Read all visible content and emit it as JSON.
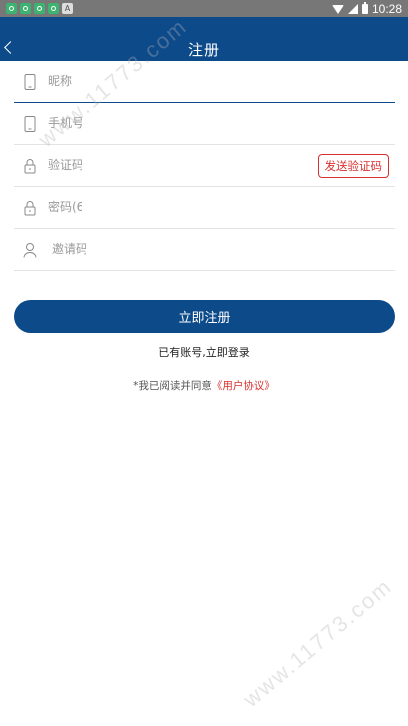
{
  "status_bar": {
    "time": "10:28",
    "notification_letter": "A"
  },
  "header": {
    "title": "注册"
  },
  "form": {
    "nickname_placeholder": "昵称",
    "phone_placeholder": "手机号",
    "code_placeholder": "验证码",
    "send_code_label": "发送验证码",
    "password_placeholder": "密码(6",
    "invite_placeholder": "邀请码"
  },
  "actions": {
    "register_label": "立即注册",
    "login_link": "已有账号,立即登录"
  },
  "agreement": {
    "prefix": "*我已阅读并同意",
    "link": "《用户协议》"
  },
  "watermark": "www.11773.com"
}
